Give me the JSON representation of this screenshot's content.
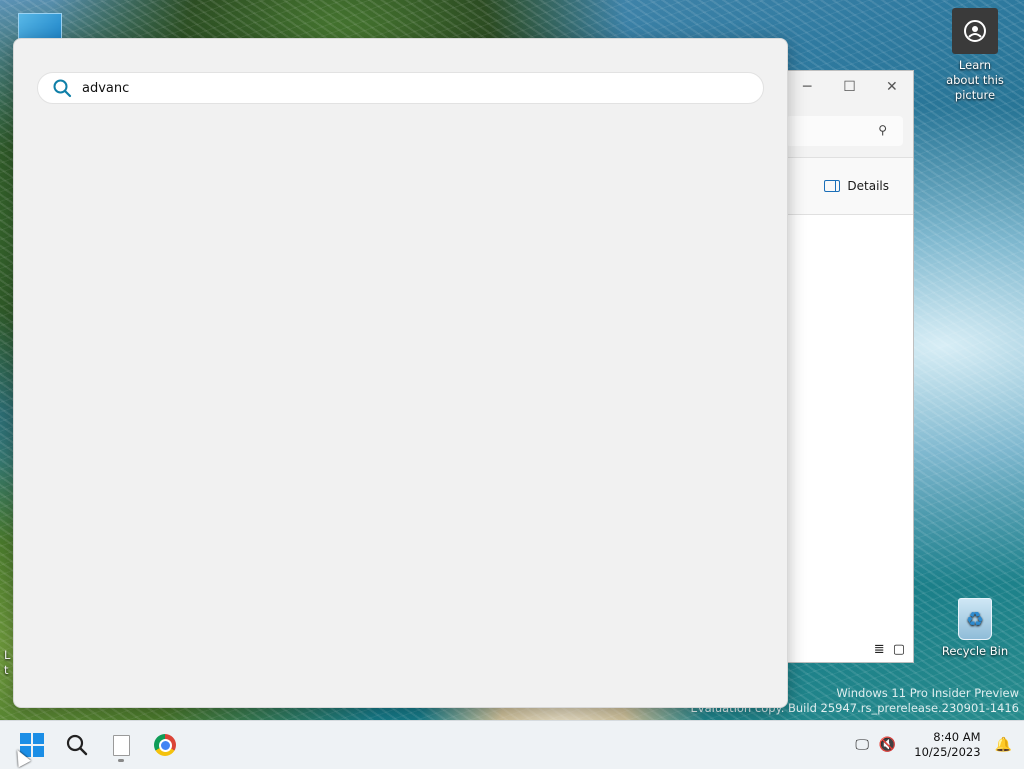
{
  "desktop": {
    "learn_icon_label": "Learn about this picture",
    "recycle_bin_label": "Recycle Bin",
    "left_partial_label_line1": "L",
    "left_partial_label_line2": "t",
    "watermark_line1": "Windows 11 Pro Insider Preview",
    "watermark_line2": "Evaluation copy. Build 25947.rs_prerelease.230901-1416"
  },
  "explorer_window": {
    "minimize_glyph": "─",
    "maximize_glyph": "☐",
    "close_glyph": "✕",
    "search_glyph": "⚲",
    "details_label": "Details",
    "list_view_glyph": "≣",
    "tiles_view_glyph": "▢"
  },
  "search_flyout": {
    "query": "advanc"
  },
  "taskbar": {
    "time": "8:40 AM",
    "date": "10/25/2023",
    "network_glyph": "🖵",
    "volume_glyph": "🔇",
    "bell_glyph": "🔔"
  },
  "colors": {
    "accent": "#1b8ee6",
    "panel_bg": "#f1f1f1",
    "search_icon": "#0f7fa8"
  }
}
